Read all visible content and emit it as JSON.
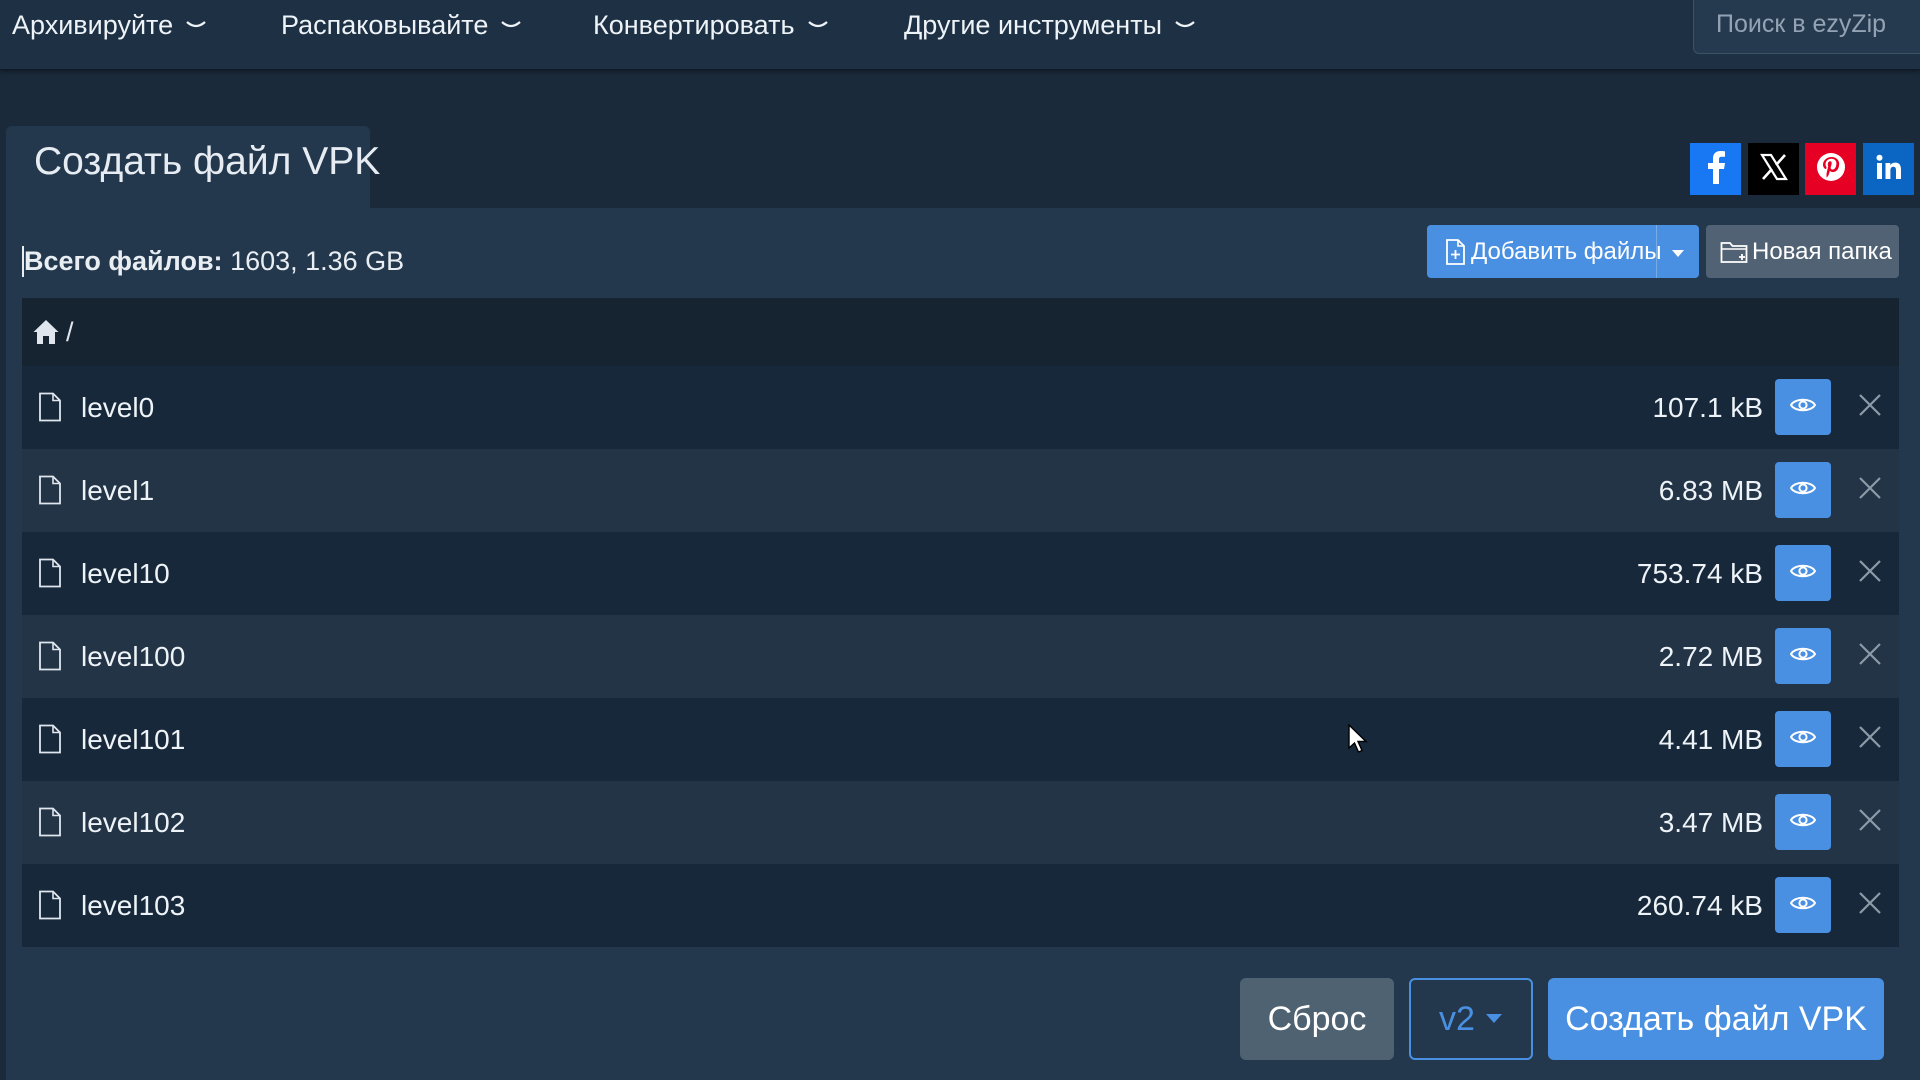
{
  "nav": {
    "items": [
      {
        "label": "Архивируйте"
      },
      {
        "label": "Распаковывайте"
      },
      {
        "label": "Конвертировать"
      },
      {
        "label": "Другие инструменты"
      }
    ],
    "search_placeholder": "Поиск в ezyZip"
  },
  "tab": {
    "title": "Создать файл VPK"
  },
  "share": [
    "facebook-icon",
    "x-icon",
    "pinterest-icon",
    "linkedin-icon"
  ],
  "summary": {
    "label": "Всего файлов:",
    "value": "1603, 1.36 GB"
  },
  "toolbar": {
    "add_files_label": "Добавить файлы",
    "new_folder_label": "Новая папка"
  },
  "breadcrumb": {
    "path": "/"
  },
  "files": [
    {
      "name": "level0",
      "size": "107.1 kB"
    },
    {
      "name": "level1",
      "size": "6.83 MB"
    },
    {
      "name": "level10",
      "size": "753.74 kB"
    },
    {
      "name": "level100",
      "size": "2.72 MB"
    },
    {
      "name": "level101",
      "size": "4.41 MB"
    },
    {
      "name": "level102",
      "size": "3.47 MB"
    },
    {
      "name": "level103",
      "size": "260.74 kB"
    }
  ],
  "actions": {
    "reset_label": "Сброс",
    "version_label": "v2",
    "create_label": "Создать файл VPK"
  },
  "colors": {
    "accent": "#4a90e2",
    "background": "#1a2a3a",
    "panel": "#24384d",
    "secondary_button": "#506273"
  }
}
